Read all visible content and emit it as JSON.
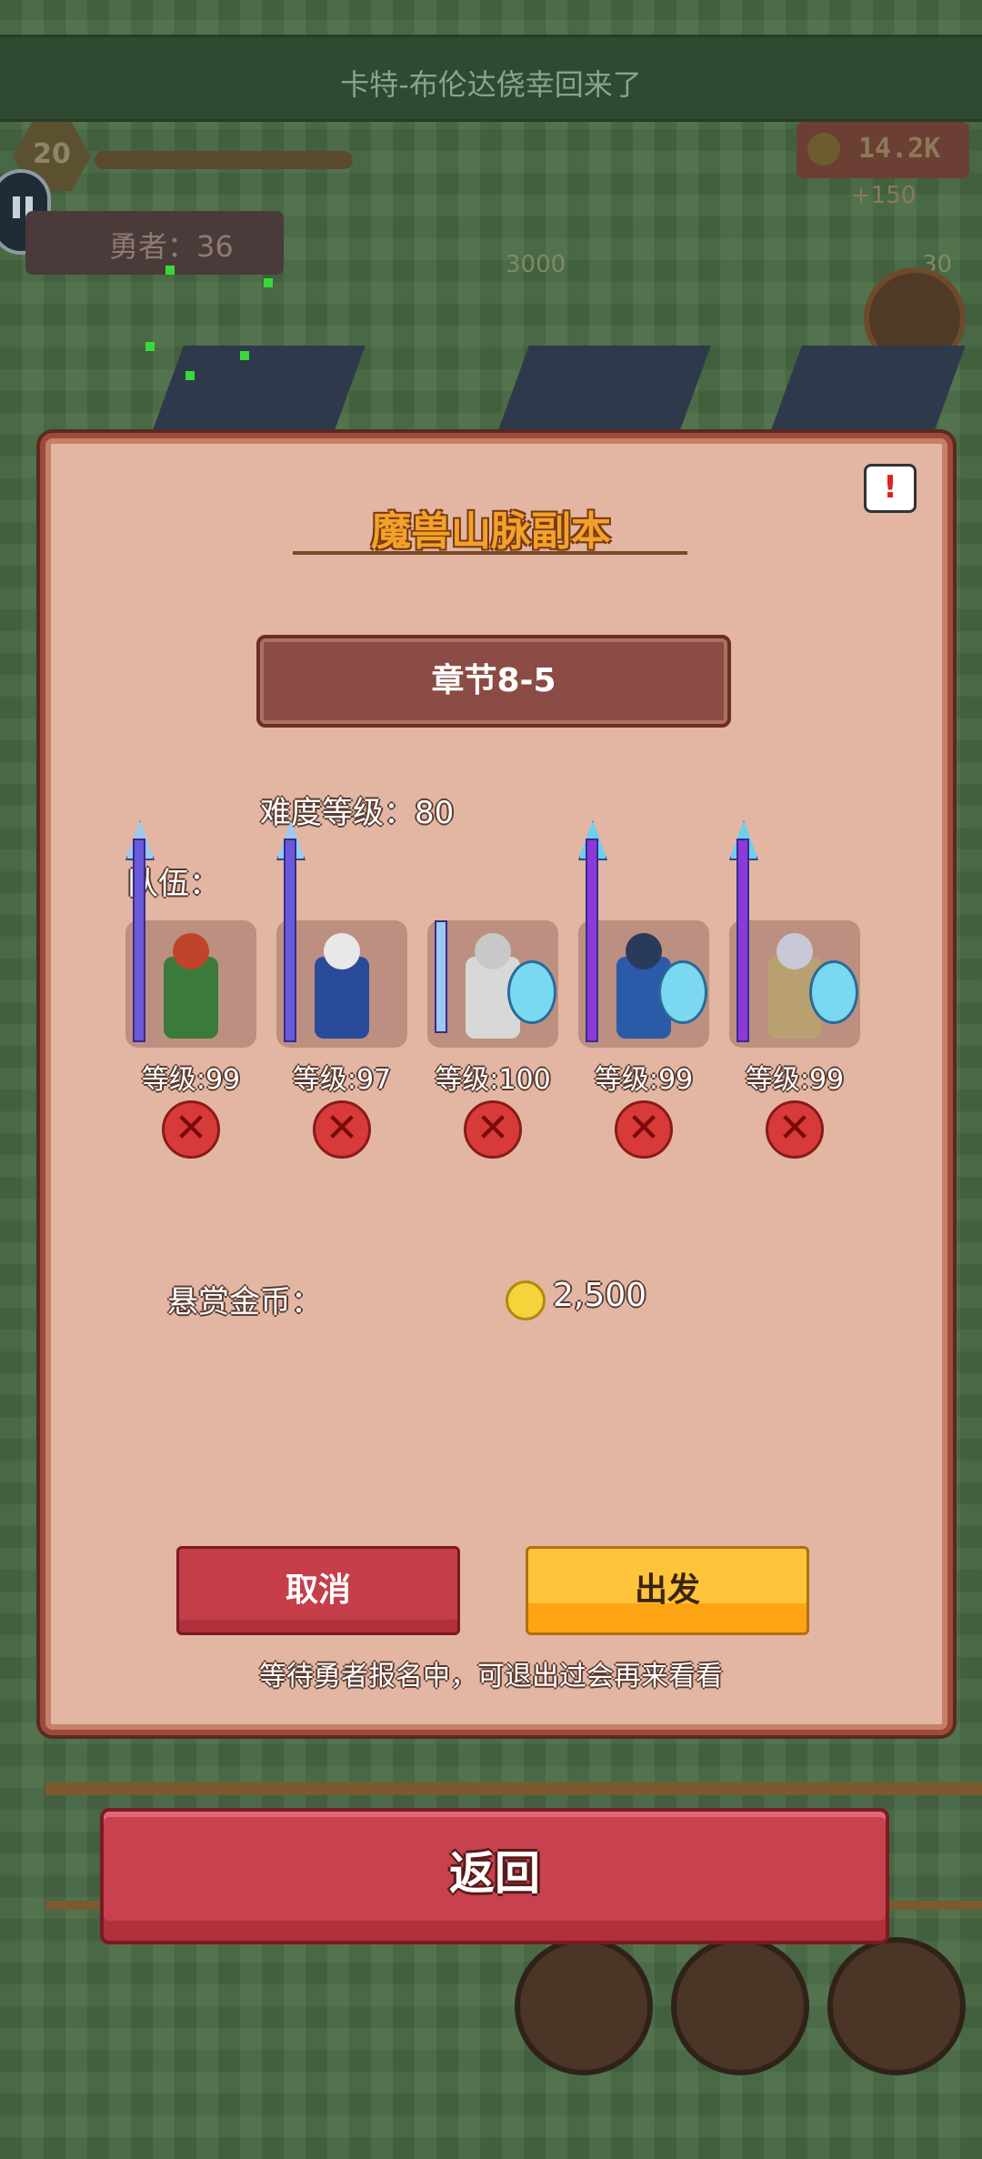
{
  "hud": {
    "ticker": "卡特-布伦达侥幸回来了",
    "player_level": "20",
    "heroes": "勇者：36",
    "coins": "14.2K",
    "coins_rate": "+150",
    "shop_price_1": "3000",
    "shop_price_2": "30"
  },
  "modal": {
    "title": "魔兽山脉副本",
    "alert_glyph": "!",
    "chapter": "章节8-5",
    "difficulty": "难度等级：80",
    "team_label": "队伍：",
    "members": [
      {
        "level": "等级:99",
        "remove": "✕"
      },
      {
        "level": "等级:97",
        "remove": "✕"
      },
      {
        "level": "等级:100",
        "remove": "✕"
      },
      {
        "level": "等级:99",
        "remove": "✕"
      },
      {
        "level": "等级:99",
        "remove": "✕"
      }
    ],
    "bounty_label": "悬赏金币：",
    "bounty_value": "2,500",
    "cancel": "取消",
    "depart": "出发",
    "wait_tip": "等待勇者报名中，可退出过会再来看看"
  },
  "back": "返回",
  "colors": {
    "modal_bg": "#e2b6a2",
    "title": "#f2a22a",
    "cancel": "#c53e4a",
    "depart": "#ffc43a",
    "back": "#c8414f"
  }
}
